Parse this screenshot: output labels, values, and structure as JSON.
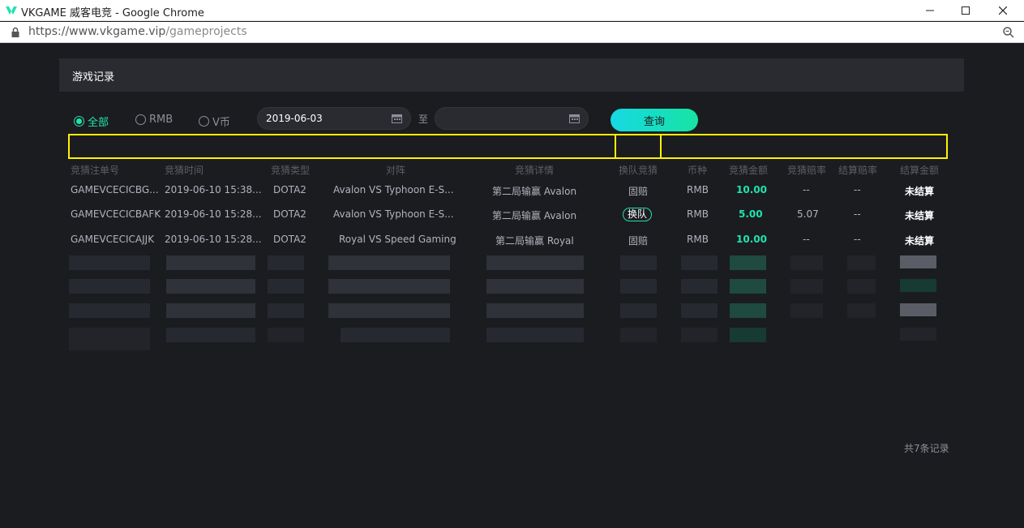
{
  "window": {
    "title": "VKGAME 威客电竞 - Google Chrome",
    "url_host": "https://www.vkgame.vip",
    "url_path": "/gameprojects"
  },
  "section": {
    "title": "游戏记录"
  },
  "filters": {
    "radios": [
      {
        "label": "全部",
        "selected": true
      },
      {
        "label": "RMB",
        "selected": false
      },
      {
        "label": "V币",
        "selected": false
      }
    ],
    "start_date": "2019-06-03",
    "end_date": "",
    "to_label": "至",
    "query_label": "查询"
  },
  "table": {
    "columns": [
      "竞猜注单号",
      "竞猜时间",
      "竞猜类型",
      "对阵",
      "竞猜详情",
      "换队竞猜",
      "币种",
      "竞猜金额",
      "竞猜赔率",
      "结算赔率",
      "结算金额"
    ],
    "rows": [
      {
        "id": "GAMEVCECICBG...",
        "time": "2019-06-10 15:38...",
        "type": "DOTA2",
        "match": "Avalon VS Typhoon E-S...",
        "detail": "第二局输赢 Avalon",
        "switch": "固赔",
        "currency": "RMB",
        "amount": "10.00",
        "odds": "--",
        "settle_odds": "--",
        "settle_amount": "未结算"
      },
      {
        "id": "GAMEVCECICBAFK",
        "time": "2019-06-10 15:28...",
        "type": "DOTA2",
        "match": "Avalon VS Typhoon E-S...",
        "detail": "第二局输赢 Avalon",
        "switch": "换队",
        "currency": "RMB",
        "amount": "5.00",
        "odds": "5.07",
        "settle_odds": "--",
        "settle_amount": "未结算"
      },
      {
        "id": "GAMEVCECICAJJK",
        "time": "2019-06-10 15:28...",
        "type": "DOTA2",
        "match": "Royal VS Speed Gaming",
        "detail": "第二局输赢 Royal",
        "switch": "固赔",
        "currency": "RMB",
        "amount": "10.00",
        "odds": "--",
        "settle_odds": "--",
        "settle_amount": "未结算"
      }
    ]
  },
  "total": "共7条记录",
  "colors": {
    "accent": "#1fe3b0",
    "highlight": "#fff200",
    "background": "#1b1c20"
  }
}
